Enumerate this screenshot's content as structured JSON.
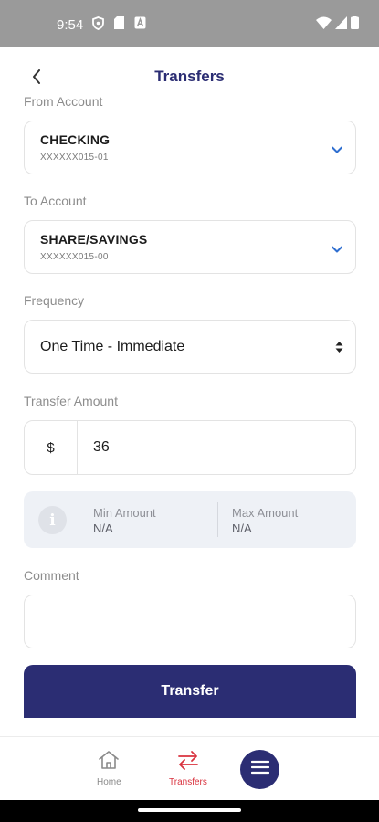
{
  "status_bar": {
    "time": "9:54",
    "left_icons": [
      "shield-icon",
      "sd-card-icon",
      "notification-a-icon"
    ],
    "right_icons": [
      "wifi-icon",
      "cellular-signal-icon",
      "battery-icon"
    ]
  },
  "header": {
    "title": "Transfers",
    "back_icon": "chevron-left-icon"
  },
  "from_account": {
    "label": "From Account",
    "name": "CHECKING",
    "number": "XXXXXX015-01"
  },
  "to_account": {
    "label": "To Account",
    "name": "SHARE/SAVINGS",
    "number": "XXXXXX015-00"
  },
  "frequency": {
    "label": "Frequency",
    "selected": "One Time - Immediate"
  },
  "amount": {
    "label": "Transfer Amount",
    "currency": "$",
    "value": "36"
  },
  "limits": {
    "info_icon": "i",
    "min_label": "Min Amount",
    "min_value": "N/A",
    "max_label": "Max Amount",
    "max_value": "N/A"
  },
  "comment": {
    "label": "Comment",
    "value": ""
  },
  "transfer_button": {
    "label": "Transfer"
  },
  "bottom_nav": {
    "home_label": "Home",
    "transfers_label": "Transfers",
    "menu_icon": "hamburger-menu-icon"
  },
  "colors": {
    "brand": "#2b2d73",
    "accent_active": "#d9333f",
    "inactive": "#8a8a8a",
    "chevron": "#2f6fd0",
    "status_bar": "#9a9a9a"
  }
}
